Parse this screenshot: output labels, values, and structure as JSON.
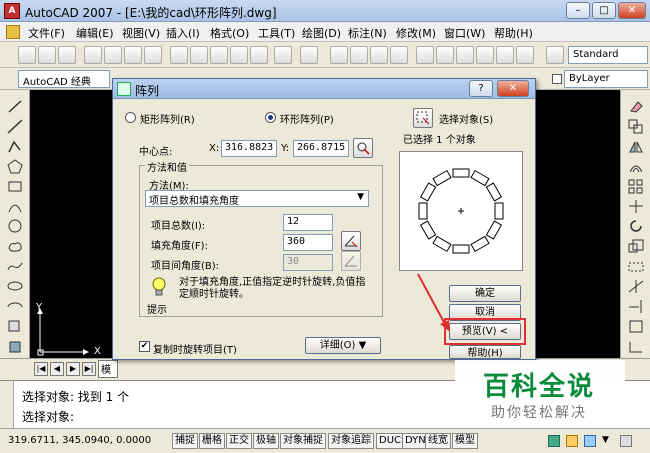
{
  "window": {
    "title": "AutoCAD 2007 - [E:\\我的cad\\环形阵列.dwg]"
  },
  "menu": [
    "文件(F)",
    "编辑(E)",
    "视图(V)",
    "插入(I)",
    "格式(O)",
    "工具(T)",
    "绘图(D)",
    "标注(N)",
    "修改(M)",
    "窗口(W)",
    "帮助(H)"
  ],
  "toolbar": {
    "workspace": "AutoCAD 经典",
    "text_style": "Standard",
    "layer": "ByLayer"
  },
  "dialog": {
    "title": "阵列",
    "rect_label": "矩形阵列(R)",
    "polar_label": "环形阵列(P)",
    "select_label": "选择对象(S)",
    "selected_text": "已选择 1 个对象",
    "center_label": "中心点:",
    "x_label": "X:",
    "x_value": "316.8823",
    "y_label": "Y:",
    "y_value": "266.8715",
    "group_label": "方法和值",
    "method_label": "方法(M):",
    "method_value": "项目总数和填充角度",
    "total_label": "项目总数(I):",
    "total_value": "12",
    "fill_label": "填充角度(F):",
    "fill_value": "360",
    "between_label": "项目间角度(B):",
    "between_value": "30",
    "tip_text": "对于填充角度,正值指定逆时针旋转,负值指定顺时针旋转。",
    "tip_label": "提示",
    "rotate_label": "复制时旋转项目(T)",
    "details_label": "详细(O) ▼",
    "ok": "确定",
    "cancel": "取消",
    "preview": "预览(V) <",
    "help": "帮助(H)"
  },
  "canvas": {
    "axis_x": "X",
    "axis_y": "Y",
    "tab_model": "模"
  },
  "command": {
    "line1": "选择对象: 找到 1 个",
    "line2": "选择对象:"
  },
  "status": {
    "coords": "319.6711, 345.0940, 0.0000",
    "buttons": [
      "捕捉",
      "栅格",
      "正交",
      "极轴",
      "对象捕捉",
      "对象追踪",
      "DUCS",
      "DYN",
      "线宽",
      "模型"
    ]
  },
  "watermark": {
    "title": "百科全说",
    "subtitle": "助你轻松解决"
  },
  "colors": {
    "accent": "#0a8a3a",
    "highlight": "#e03030"
  }
}
